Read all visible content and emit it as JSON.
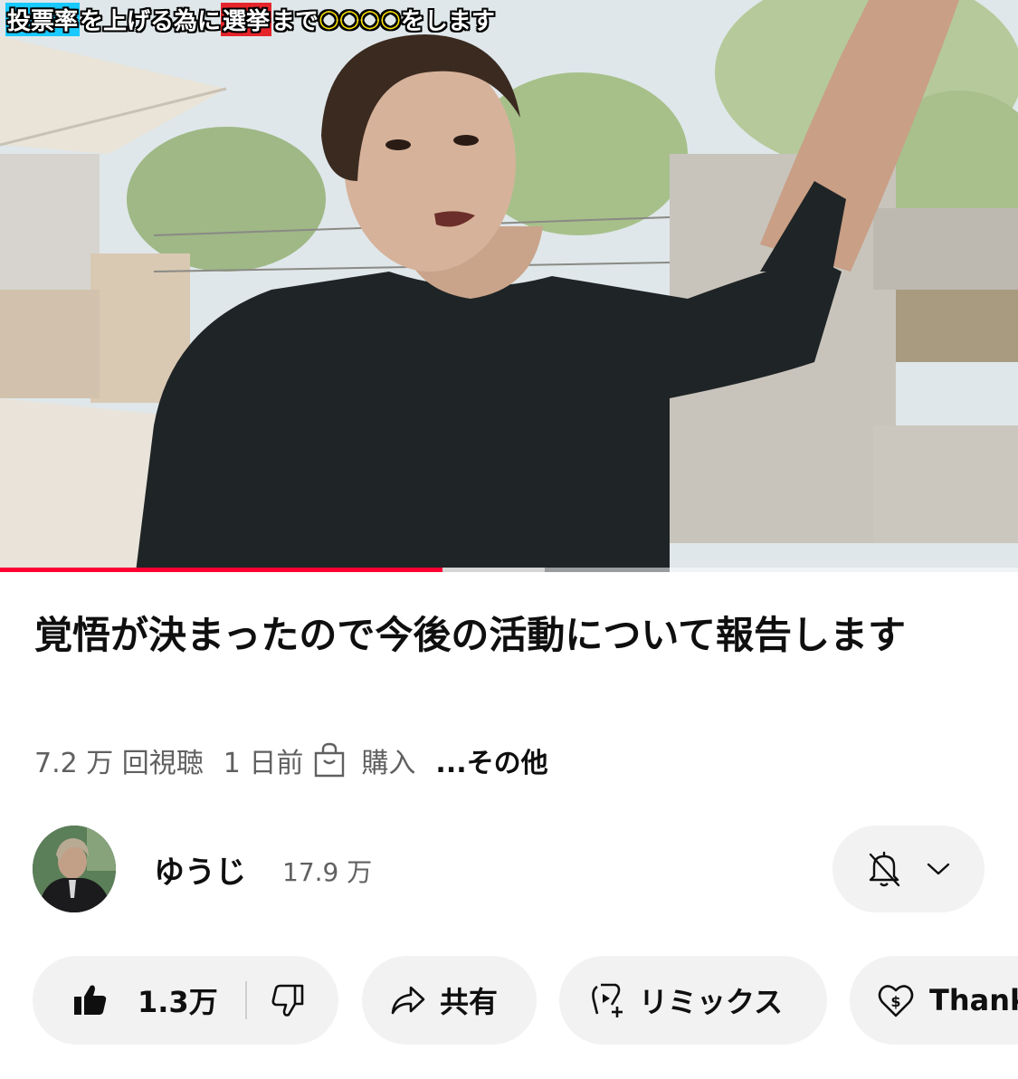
{
  "video": {
    "caption": {
      "part1": "投票率",
      "part2": "を上げる為に",
      "part3": "選挙",
      "part4": "まで",
      "part5": "○○○○",
      "part6": "をします"
    },
    "progress": {
      "played_fraction": 0.435,
      "buffered_fraction": 0.535
    }
  },
  "title": "覚悟が決まったので今後の活動について報告します",
  "meta": {
    "views": "7.2 万 回視聴",
    "age": "1 日前",
    "shopping_icon": "shopping-bag-icon",
    "shopping_label": "購入",
    "more": "...その他"
  },
  "channel": {
    "name": "ゆうじ",
    "subscribers": "17.9 万",
    "notification_icon": "bell-off-icon",
    "dropdown_icon": "chevron-down-icon"
  },
  "actions": {
    "like_count": "1.3万",
    "share_label": "共有",
    "remix_label": "リミックス",
    "thanks_label": "Thanks"
  },
  "colors": {
    "progress_played": "#ff0033",
    "pill_bg": "#f2f2f2",
    "meta_text": "#606060"
  }
}
